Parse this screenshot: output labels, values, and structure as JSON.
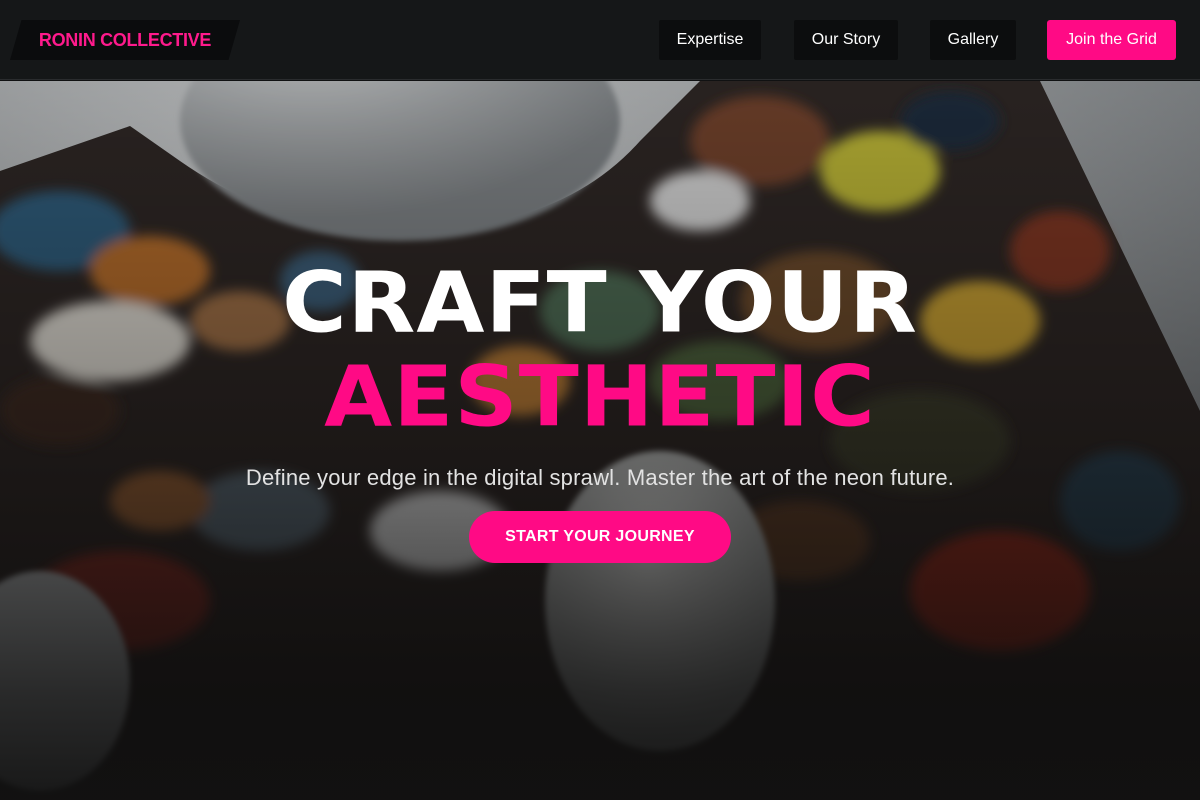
{
  "header": {
    "logo_text": "RONIN COLLECTIVE",
    "nav": [
      {
        "label": "Expertise"
      },
      {
        "label": "Our Story"
      },
      {
        "label": "Gallery"
      }
    ],
    "cta_label": "Join the Grid"
  },
  "hero": {
    "headline_line1": "CRAFT YOUR",
    "headline_line2": "AESTHETIC",
    "subtitle": "Define your edge in the digital sprawl. Master the art of the neon future.",
    "button_label": "START YOUR JOURNEY"
  },
  "colors": {
    "accent": "#ff0a85",
    "header_bg": "#151718",
    "nav_button_bg": "#0c0d0e"
  }
}
